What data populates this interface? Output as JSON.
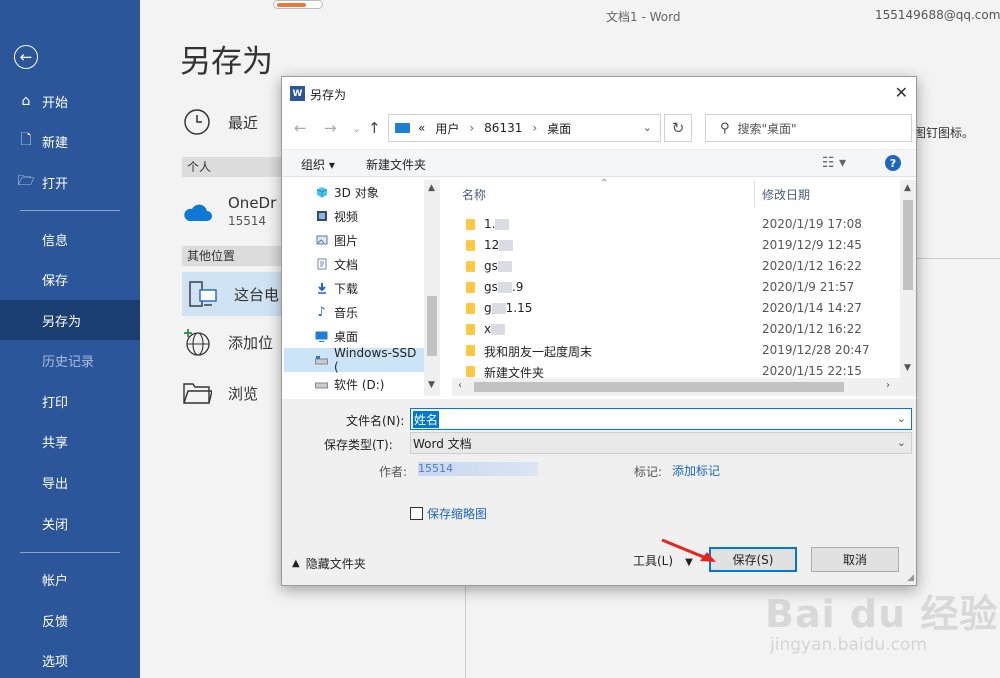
{
  "window": {
    "doc_title": "文档1 - Word",
    "account": "155149688@qq.com"
  },
  "sidebar": {
    "back_icon": "←",
    "items": [
      {
        "label": "开始",
        "icon": "⌂"
      },
      {
        "label": "新建",
        "icon": "🗋"
      },
      {
        "label": "打开",
        "icon": "🗁"
      },
      {
        "label": "信息"
      },
      {
        "label": "保存"
      },
      {
        "label": "另存为"
      },
      {
        "label": "历史记录"
      },
      {
        "label": "打印"
      },
      {
        "label": "共享"
      },
      {
        "label": "导出"
      },
      {
        "label": "关闭"
      },
      {
        "label": "帐户"
      },
      {
        "label": "反馈"
      },
      {
        "label": "选项"
      }
    ],
    "active_index": 5,
    "colors": {
      "bg": "#2b579a",
      "active": "#1b3e73"
    }
  },
  "main": {
    "page_title": "另存为",
    "recent": "最近",
    "personal_label": "个人",
    "onedrive_name": "OneDr",
    "onedrive_sub": "15514",
    "other_label": "其他位置",
    "this_pc": "这台电",
    "add_location": "添加位",
    "browse": "浏览",
    "right_note": "图钉图标。",
    "progress_fraction": 0.6
  },
  "dialog": {
    "title": "另存为",
    "word_icon": "W",
    "close": "✕",
    "address": {
      "prefix": "«",
      "crumbs": [
        "用户",
        "86131",
        "桌面"
      ]
    },
    "search_placeholder": "搜索\"桌面\"",
    "toolbar": {
      "organize": "组织 ▾",
      "new_folder": "新建文件夹",
      "help": "?"
    },
    "tree": [
      {
        "label": "3D 对象",
        "icon": "cube-icon"
      },
      {
        "label": "视频",
        "icon": "video-icon"
      },
      {
        "label": "图片",
        "icon": "picture-icon"
      },
      {
        "label": "文档",
        "icon": "document-icon"
      },
      {
        "label": "下载",
        "icon": "download-icon"
      },
      {
        "label": "音乐",
        "icon": "music-icon"
      },
      {
        "label": "桌面",
        "icon": "desktop-icon"
      },
      {
        "label": "Windows-SSD (",
        "icon": "drive-icon"
      },
      {
        "label": "软件 (D:)",
        "icon": "drive-icon"
      }
    ],
    "selected_tree_index": 7,
    "columns": {
      "name": "名称",
      "date": "修改日期"
    },
    "files": [
      {
        "prefix": "1.",
        "suffix": "",
        "date": "2020/1/19 17:08"
      },
      {
        "prefix": "12",
        "suffix": "",
        "date": "2019/12/9 12:45"
      },
      {
        "prefix": "gs",
        "suffix": "",
        "date": "2020/1/12 16:22"
      },
      {
        "prefix": "gs",
        "suffix": ".9",
        "date": "2020/1/9 21:57"
      },
      {
        "prefix": "g",
        "suffix": "1.15",
        "date": "2020/1/14 14:27"
      },
      {
        "prefix": "x",
        "suffix": "",
        "date": "2020/1/12 16:22"
      },
      {
        "prefix": "我和朋友一起度周末",
        "suffix": "",
        "date": "2019/12/28 20:47"
      },
      {
        "prefix": "新建文件夹",
        "suffix": "",
        "date": "2020/1/15 22:15"
      }
    ],
    "form": {
      "filename_label": "文件名(N):",
      "filename_value": "姓名",
      "filetype_label": "保存类型(T):",
      "filetype_value": "Word 文档",
      "author_label": "作者:",
      "author_value": "15514",
      "tags_label": "标记:",
      "tags_link": "添加标记",
      "thumbnail_label": "保存缩略图",
      "hide_folders": "隐藏文件夹",
      "tools": "工具(L)",
      "save": "保存(S)",
      "cancel": "取消"
    }
  },
  "watermark": {
    "main": "Bai  du 经验",
    "sub": "jingyan.baidu.com"
  }
}
